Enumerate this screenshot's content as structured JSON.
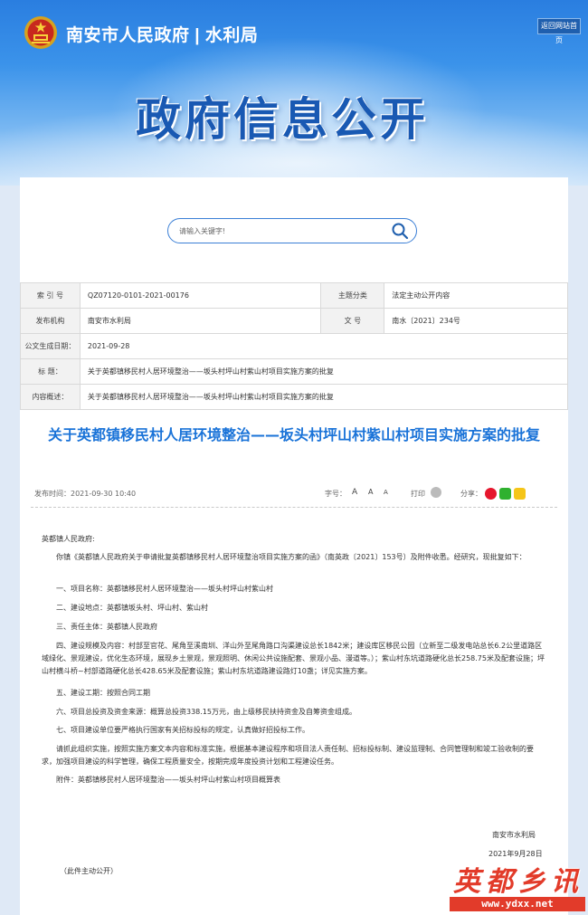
{
  "header": {
    "site_title": "南安市人民政府 | 水利局",
    "home_button": "返回网站首页",
    "banner_title": "政府信息公开"
  },
  "search": {
    "placeholder": "请输入关键字!"
  },
  "meta": {
    "index_label": "索 引 号",
    "index_value": "QZ07120-0101-2021-00176",
    "topic_label": "主题分类",
    "topic_value": "法定主动公开内容",
    "publisher_label": "发布机构",
    "publisher_value": "南安市水利局",
    "docno_label": "文    号",
    "docno_value": "南水〔2021〕234号",
    "date_label": "公文生成日期：",
    "date_value": "2021-09-28",
    "title_label": "标    题：",
    "title_value": "关于英都镇移民村人居环境整治——坂头村坪山村紫山村项目实施方案的批复",
    "summary_label": "内容概述：",
    "summary_value": "关于英都镇移民村人居环境整治——坂头村坪山村紫山村项目实施方案的批复"
  },
  "article": {
    "title": "关于英都镇移民村人居环境整治——坂头村坪山村紫山村项目实施方案的批复",
    "pub_time": "发布时间：2021-09-30 10:40",
    "font_label": "字号：",
    "font_sizes": [
      "A",
      "A",
      "A"
    ],
    "print_label": "打印",
    "share_label": "分享：",
    "paragraphs": [
      "英都镇人民政府:",
      "你镇《英都镇人民政府关于申请批复英都镇移民村人居环境整治项目实施方案的函》（南英政〔2021〕153号）及附件收悉。经研究，现批复如下：",
      "一、项目名称：英都镇移民村人居环境整治——坂头村坪山村紫山村",
      "二、建设地点：英都镇坂头村、坪山村、紫山村",
      "三、责任主体：英都镇人民政府",
      "四、建设规模及内容：村部至官花、尾角至溪南圳、洋山外至尾角路口沟渠建设总长1842米；建设库区移民公园（立新至二级发电站总长6.2公里道路区域绿化、景观建设，优化生态环境，展现乡土景观，景观照明、休闲公共设施配套、景观小品、漫道等。）；紫山村东坑道路硬化总长258.75米及配套设施；坪山村横斗桥~村部道路硬化总长428.65米及配套设施；紫山村东坑道路建设路灯10盏；详见实施方案。",
      "五、建设工期：按照合同工期",
      "六、项目总投资及资金来源：概算总投资338.15万元，由上级移民扶持资金及自筹资金组成。",
      "七、项目建设单位要严格执行国家有关招标投标的规定，认真做好招投标工作。",
      "请抓此组织实施，按照实施方案文本内容和标准实施，根据基本建设程序和项目法人责任制、招标投标制、建设监理制、合同管理制和竣工验收制的要求，加强项目建设的科学管理，确保工程质量安全，按期完成年度投资计划和工程建设任务。",
      "附件：英都镇移民村人居环境整治——坂头村坪山村紫山村项目概算表"
    ],
    "signature_org": "南安市水利局",
    "signature_date": "2021年9月28日",
    "disclosure": "（此件主动公开）"
  },
  "watermark": {
    "text": "英都乡讯",
    "url": "www.ydxx.net"
  },
  "colors": {
    "accent": "#1a73d8",
    "banner_title": "#1959b3",
    "watermark": "#e23b2a"
  }
}
